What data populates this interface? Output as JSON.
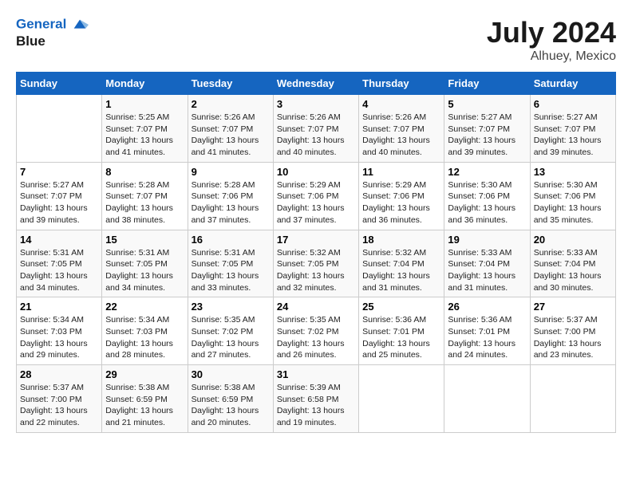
{
  "logo": {
    "line1": "General",
    "line2": "Blue"
  },
  "title": "July 2024",
  "subtitle": "Alhuey, Mexico",
  "header_row": [
    "Sunday",
    "Monday",
    "Tuesday",
    "Wednesday",
    "Thursday",
    "Friday",
    "Saturday"
  ],
  "weeks": [
    [
      {
        "day": "",
        "sunrise": "",
        "sunset": "",
        "daylight": ""
      },
      {
        "day": "1",
        "sunrise": "Sunrise: 5:25 AM",
        "sunset": "Sunset: 7:07 PM",
        "daylight": "Daylight: 13 hours and 41 minutes."
      },
      {
        "day": "2",
        "sunrise": "Sunrise: 5:26 AM",
        "sunset": "Sunset: 7:07 PM",
        "daylight": "Daylight: 13 hours and 41 minutes."
      },
      {
        "day": "3",
        "sunrise": "Sunrise: 5:26 AM",
        "sunset": "Sunset: 7:07 PM",
        "daylight": "Daylight: 13 hours and 40 minutes."
      },
      {
        "day": "4",
        "sunrise": "Sunrise: 5:26 AM",
        "sunset": "Sunset: 7:07 PM",
        "daylight": "Daylight: 13 hours and 40 minutes."
      },
      {
        "day": "5",
        "sunrise": "Sunrise: 5:27 AM",
        "sunset": "Sunset: 7:07 PM",
        "daylight": "Daylight: 13 hours and 39 minutes."
      },
      {
        "day": "6",
        "sunrise": "Sunrise: 5:27 AM",
        "sunset": "Sunset: 7:07 PM",
        "daylight": "Daylight: 13 hours and 39 minutes."
      }
    ],
    [
      {
        "day": "7",
        "sunrise": "Sunrise: 5:27 AM",
        "sunset": "Sunset: 7:07 PM",
        "daylight": "Daylight: 13 hours and 39 minutes."
      },
      {
        "day": "8",
        "sunrise": "Sunrise: 5:28 AM",
        "sunset": "Sunset: 7:07 PM",
        "daylight": "Daylight: 13 hours and 38 minutes."
      },
      {
        "day": "9",
        "sunrise": "Sunrise: 5:28 AM",
        "sunset": "Sunset: 7:06 PM",
        "daylight": "Daylight: 13 hours and 37 minutes."
      },
      {
        "day": "10",
        "sunrise": "Sunrise: 5:29 AM",
        "sunset": "Sunset: 7:06 PM",
        "daylight": "Daylight: 13 hours and 37 minutes."
      },
      {
        "day": "11",
        "sunrise": "Sunrise: 5:29 AM",
        "sunset": "Sunset: 7:06 PM",
        "daylight": "Daylight: 13 hours and 36 minutes."
      },
      {
        "day": "12",
        "sunrise": "Sunrise: 5:30 AM",
        "sunset": "Sunset: 7:06 PM",
        "daylight": "Daylight: 13 hours and 36 minutes."
      },
      {
        "day": "13",
        "sunrise": "Sunrise: 5:30 AM",
        "sunset": "Sunset: 7:06 PM",
        "daylight": "Daylight: 13 hours and 35 minutes."
      }
    ],
    [
      {
        "day": "14",
        "sunrise": "Sunrise: 5:31 AM",
        "sunset": "Sunset: 7:05 PM",
        "daylight": "Daylight: 13 hours and 34 minutes."
      },
      {
        "day": "15",
        "sunrise": "Sunrise: 5:31 AM",
        "sunset": "Sunset: 7:05 PM",
        "daylight": "Daylight: 13 hours and 34 minutes."
      },
      {
        "day": "16",
        "sunrise": "Sunrise: 5:31 AM",
        "sunset": "Sunset: 7:05 PM",
        "daylight": "Daylight: 13 hours and 33 minutes."
      },
      {
        "day": "17",
        "sunrise": "Sunrise: 5:32 AM",
        "sunset": "Sunset: 7:05 PM",
        "daylight": "Daylight: 13 hours and 32 minutes."
      },
      {
        "day": "18",
        "sunrise": "Sunrise: 5:32 AM",
        "sunset": "Sunset: 7:04 PM",
        "daylight": "Daylight: 13 hours and 31 minutes."
      },
      {
        "day": "19",
        "sunrise": "Sunrise: 5:33 AM",
        "sunset": "Sunset: 7:04 PM",
        "daylight": "Daylight: 13 hours and 31 minutes."
      },
      {
        "day": "20",
        "sunrise": "Sunrise: 5:33 AM",
        "sunset": "Sunset: 7:04 PM",
        "daylight": "Daylight: 13 hours and 30 minutes."
      }
    ],
    [
      {
        "day": "21",
        "sunrise": "Sunrise: 5:34 AM",
        "sunset": "Sunset: 7:03 PM",
        "daylight": "Daylight: 13 hours and 29 minutes."
      },
      {
        "day": "22",
        "sunrise": "Sunrise: 5:34 AM",
        "sunset": "Sunset: 7:03 PM",
        "daylight": "Daylight: 13 hours and 28 minutes."
      },
      {
        "day": "23",
        "sunrise": "Sunrise: 5:35 AM",
        "sunset": "Sunset: 7:02 PM",
        "daylight": "Daylight: 13 hours and 27 minutes."
      },
      {
        "day": "24",
        "sunrise": "Sunrise: 5:35 AM",
        "sunset": "Sunset: 7:02 PM",
        "daylight": "Daylight: 13 hours and 26 minutes."
      },
      {
        "day": "25",
        "sunrise": "Sunrise: 5:36 AM",
        "sunset": "Sunset: 7:01 PM",
        "daylight": "Daylight: 13 hours and 25 minutes."
      },
      {
        "day": "26",
        "sunrise": "Sunrise: 5:36 AM",
        "sunset": "Sunset: 7:01 PM",
        "daylight": "Daylight: 13 hours and 24 minutes."
      },
      {
        "day": "27",
        "sunrise": "Sunrise: 5:37 AM",
        "sunset": "Sunset: 7:00 PM",
        "daylight": "Daylight: 13 hours and 23 minutes."
      }
    ],
    [
      {
        "day": "28",
        "sunrise": "Sunrise: 5:37 AM",
        "sunset": "Sunset: 7:00 PM",
        "daylight": "Daylight: 13 hours and 22 minutes."
      },
      {
        "day": "29",
        "sunrise": "Sunrise: 5:38 AM",
        "sunset": "Sunset: 6:59 PM",
        "daylight": "Daylight: 13 hours and 21 minutes."
      },
      {
        "day": "30",
        "sunrise": "Sunrise: 5:38 AM",
        "sunset": "Sunset: 6:59 PM",
        "daylight": "Daylight: 13 hours and 20 minutes."
      },
      {
        "day": "31",
        "sunrise": "Sunrise: 5:39 AM",
        "sunset": "Sunset: 6:58 PM",
        "daylight": "Daylight: 13 hours and 19 minutes."
      },
      {
        "day": "",
        "sunrise": "",
        "sunset": "",
        "daylight": ""
      },
      {
        "day": "",
        "sunrise": "",
        "sunset": "",
        "daylight": ""
      },
      {
        "day": "",
        "sunrise": "",
        "sunset": "",
        "daylight": ""
      }
    ]
  ]
}
